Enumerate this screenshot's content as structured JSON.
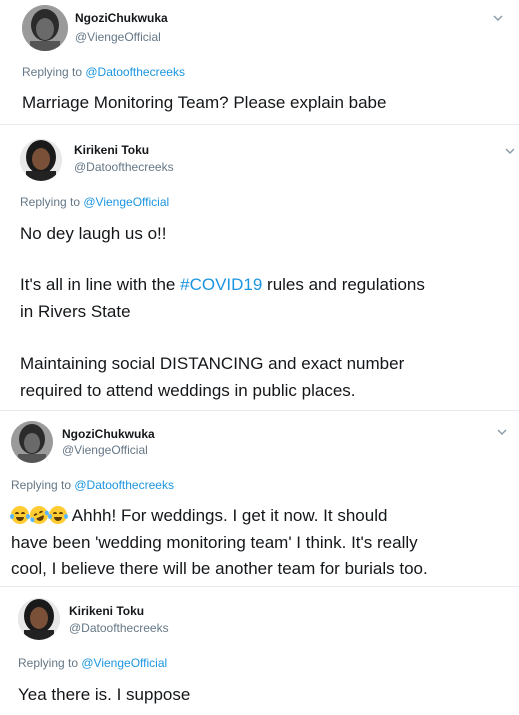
{
  "tweets": [
    {
      "name": "NgoziChukwuka",
      "handle": "@ViengeOfficial",
      "replying_prefix": "Replying to ",
      "replying_to": "@Datoofthecreeks",
      "text": "Marriage Monitoring Team? Please explain babe"
    },
    {
      "name": "Kirikeni Toku",
      "handle": "@Datoofthecreeks",
      "replying_prefix": "Replying to ",
      "replying_to": "@ViengeOfficial",
      "line1": "No dey laugh us o!!",
      "line2_pre": "It's all in line with the ",
      "hashtag": "#COVID19",
      "line2_post": " rules and regulations",
      "line3": "in Rivers State",
      "line4": "Maintaining social DISTANCING and exact number",
      "line5": "required to attend weddings in public places."
    },
    {
      "name": "NgoziChukwuka",
      "handle": "@ViengeOfficial",
      "replying_prefix": "Replying to ",
      "replying_to": "@Datoofthecreeks",
      "emojis": [
        "face-with-tears-of-joy",
        "rolling-on-floor-laughing",
        "face-with-tears-of-joy"
      ],
      "line1": "Ahhh!  For weddings. I get it now. It should",
      "line2": "have been 'wedding monitoring team' I think. It's really",
      "line3": "cool, I believe there will be another team for burials too."
    },
    {
      "name": "Kirikeni Toku",
      "handle": "@Datoofthecreeks",
      "replying_prefix": "Replying to ",
      "replying_to": "@ViengeOfficial",
      "text": "Yea there is. I suppose"
    }
  ],
  "colors": {
    "link": "#1b95e0",
    "secondary": "#657786",
    "primary": "#14171a"
  }
}
